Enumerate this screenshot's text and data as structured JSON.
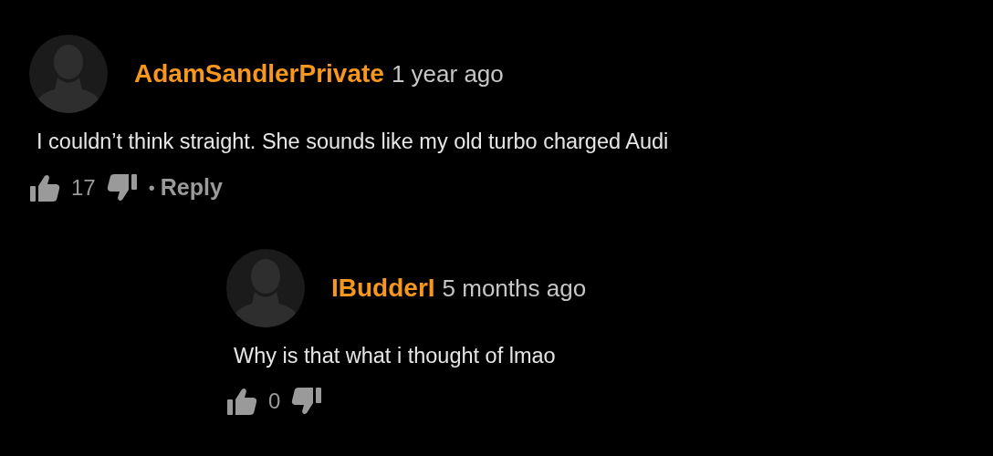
{
  "comments": [
    {
      "author": "AdamSandlerPrivate",
      "time": "1 year ago",
      "text": "I couldn’t think straight. She sounds like my old turbo charged Audi",
      "likes": "17",
      "separator": "•",
      "reply": "Reply",
      "children": [
        {
          "author": "IBudderI",
          "time": "5 months ago",
          "text": "Why is that what i thought of lmao",
          "likes": "0"
        }
      ]
    }
  ]
}
